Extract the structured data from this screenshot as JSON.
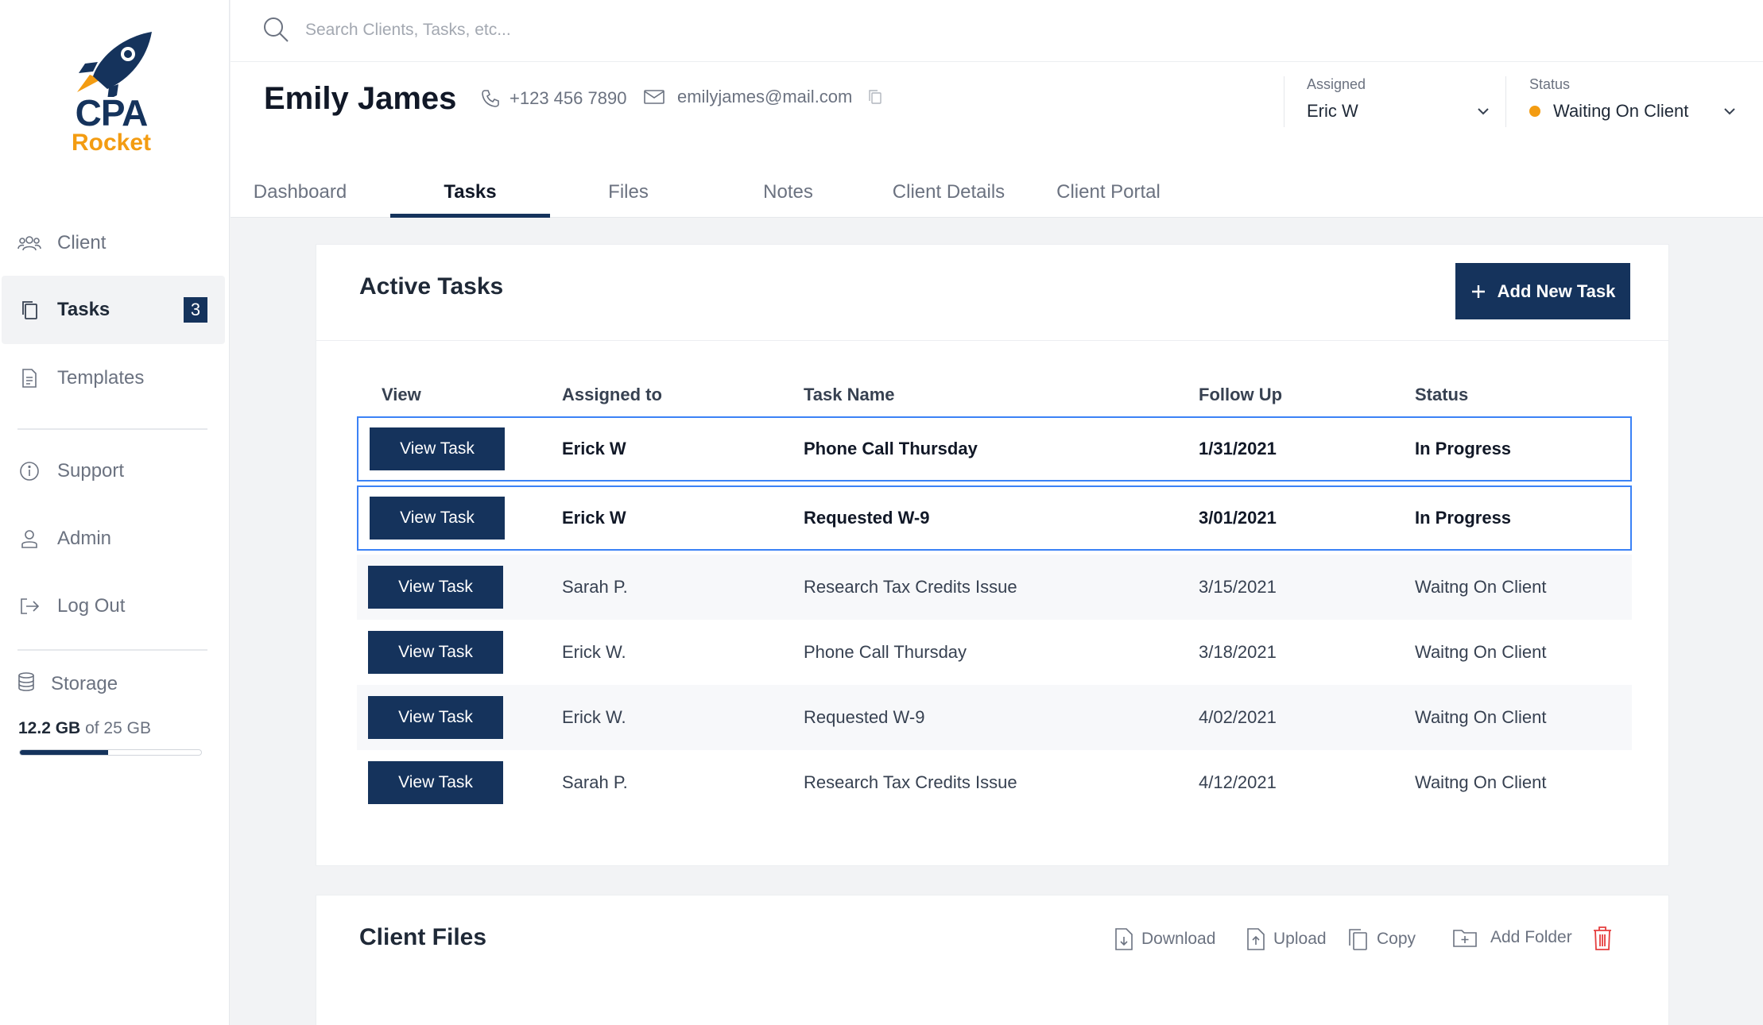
{
  "logo": {
    "line1": "CPA",
    "line2": "Rocket"
  },
  "colors": {
    "primary": "#15335c",
    "accent": "#f39c12",
    "highlight": "#3b82f6",
    "danger": "#e53e3e"
  },
  "sidebar": {
    "items": [
      {
        "label": "Client",
        "icon": "users-icon"
      },
      {
        "label": "Tasks",
        "icon": "copy-icon",
        "badge": "3"
      },
      {
        "label": "Templates",
        "icon": "document-icon"
      },
      {
        "label": "Support",
        "icon": "info-icon"
      },
      {
        "label": "Admin",
        "icon": "admin-user-icon"
      },
      {
        "label": "Log Out",
        "icon": "logout-icon"
      }
    ],
    "storage": {
      "label": "Storage",
      "used": "12.2 GB",
      "total_text": "of 25 GB",
      "fraction": 0.488
    }
  },
  "search": {
    "placeholder": "Search Clients, Tasks, etc..."
  },
  "client": {
    "name": "Emily James",
    "phone": "+123 456 7890",
    "email": "emilyjames@mail.com"
  },
  "assigned": {
    "label": "Assigned",
    "value": "Eric W"
  },
  "status": {
    "label": "Status",
    "value": "Waiting On Client"
  },
  "tabs": [
    "Dashboard",
    "Tasks",
    "Files",
    "Notes",
    "Client Details",
    "Client Portal"
  ],
  "active_tab": "Tasks",
  "tasks": {
    "title": "Active Tasks",
    "add_label": "Add New Task",
    "columns": [
      "View",
      "Assigned to",
      "Task Name",
      "Follow Up",
      "Status"
    ],
    "view_label": "View Task",
    "rows": [
      {
        "assigned": "Erick W",
        "task": "Phone Call Thursday",
        "follow_up": "1/31/2021",
        "status": "In Progress"
      },
      {
        "assigned": "Erick W",
        "task": "Requested W-9",
        "follow_up": "3/01/2021",
        "status": "In Progress"
      },
      {
        "assigned": "Sarah P.",
        "task": "Research Tax Credits Issue",
        "follow_up": "3/15/2021",
        "status": "Waitng On Client"
      },
      {
        "assigned": "Erick W.",
        "task": "Phone Call Thursday",
        "follow_up": "3/18/2021",
        "status": "Waitng On Client"
      },
      {
        "assigned": "Erick W.",
        "task": "Requested W-9",
        "follow_up": "4/02/2021",
        "status": "Waitng On Client"
      },
      {
        "assigned": "Sarah P.",
        "task": "Research Tax Credits Issue",
        "follow_up": "4/12/2021",
        "status": "Waitng On Client"
      }
    ]
  },
  "files": {
    "title": "Client Files",
    "actions": {
      "download": "Download",
      "upload": "Upload",
      "copy": "Copy",
      "add_folder": "Add Folder"
    }
  }
}
